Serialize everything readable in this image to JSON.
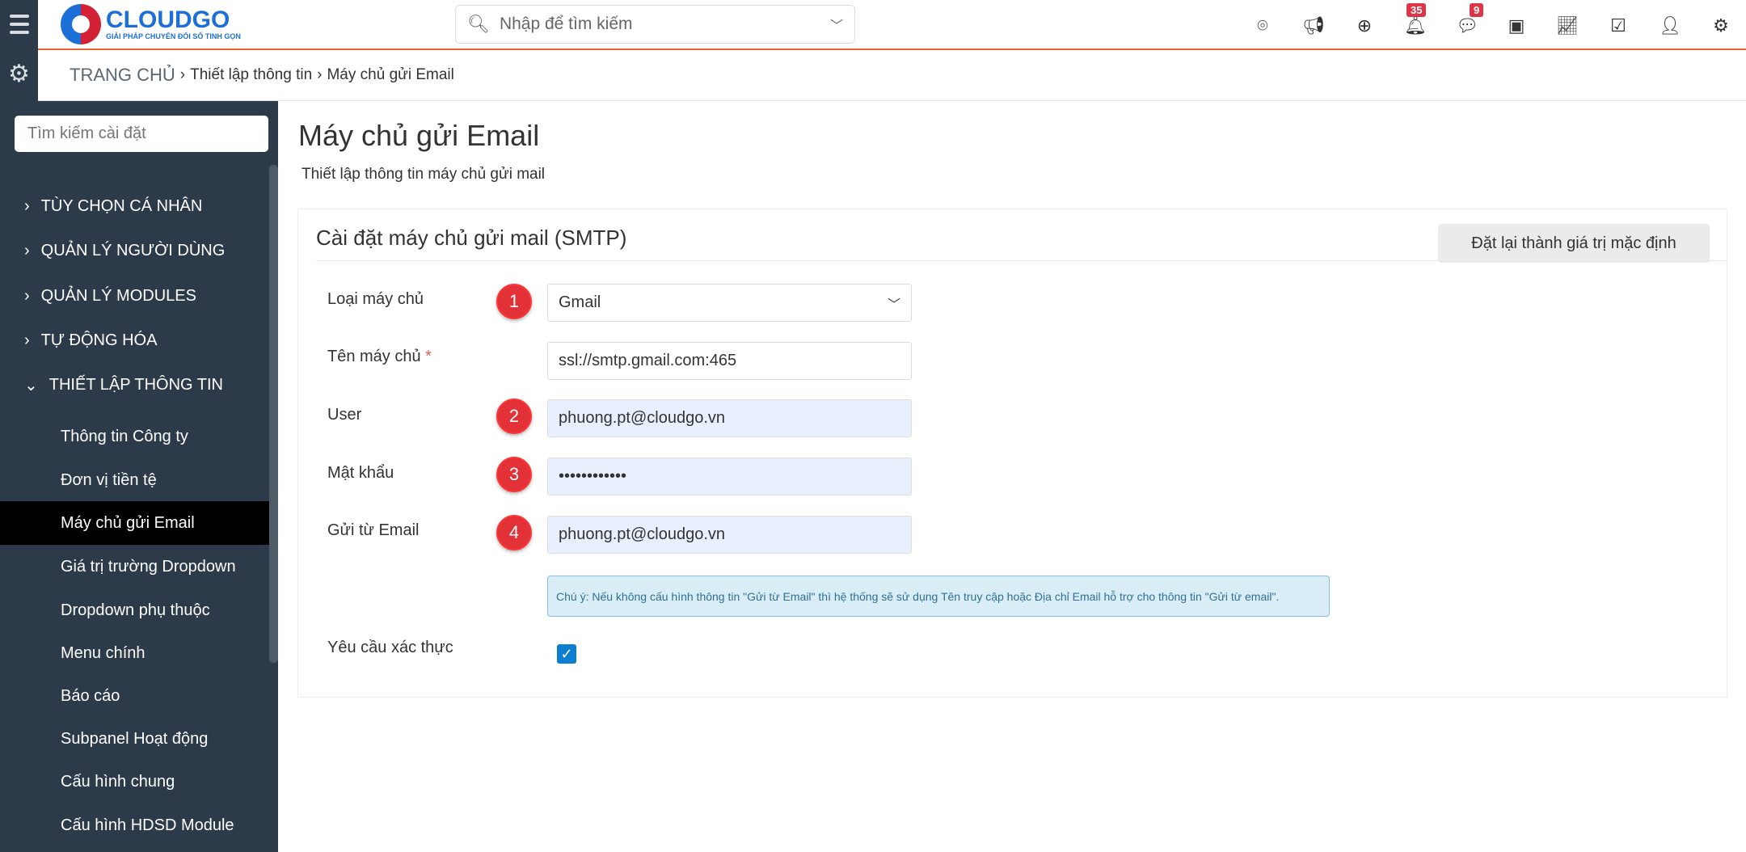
{
  "header": {
    "logo": {
      "name": "CLOUDGO",
      "tagline": "GIẢI PHÁP CHUYỂN ĐỔI SỐ TINH GỌN"
    },
    "search_placeholder": "Nhập để tìm kiếm",
    "notifications_count": "35",
    "messages_count": "9",
    "accent": "#e8622a"
  },
  "breadcrumb": {
    "home": "TRANG CHỦ",
    "items": [
      "Thiết lập thông tin",
      "Máy chủ gửi Email"
    ]
  },
  "sidebar": {
    "search_placeholder": "Tìm kiếm cài đặt",
    "sections": [
      "TÙY CHỌN CÁ NHÂN",
      "QUẢN LÝ NGƯỜI DÙNG",
      "QUẢN LÝ MODULES",
      "TỰ ĐỘNG HÓA",
      "THIẾT LẬP THÔNG TIN"
    ],
    "items": [
      "Thông tin Công ty",
      "Đơn vị tiền tệ",
      "Máy chủ gửi Email",
      "Giá trị trường Dropdown",
      "Dropdown phụ thuộc",
      "Menu chính",
      "Báo cáo",
      "Subpanel Hoạt động",
      "Cấu hình chung",
      "Cấu hình HDSD Module"
    ],
    "active": "Máy chủ gửi Email"
  },
  "page": {
    "title": "Máy chủ gửi Email",
    "subtitle": "Thiết lập thông tin máy chủ gửi mail"
  },
  "card": {
    "title": "Cài đặt máy chủ gửi mail (SMTP)",
    "reset_label": "Đặt lại thành giá trị mặc định",
    "fields": {
      "server_type": {
        "label": "Loại máy chủ",
        "value": "Gmail",
        "marker": "1"
      },
      "server_name": {
        "label": "Tên máy chủ",
        "required": "*",
        "value": "ssl://smtp.gmail.com:465"
      },
      "user": {
        "label": "User",
        "value": "phuong.pt@cloudgo.vn",
        "marker": "2"
      },
      "password": {
        "label": "Mật khẩu",
        "value": "••••••••••••",
        "marker": "3"
      },
      "from_email": {
        "label": "Gửi từ Email",
        "value": "phuong.pt@cloudgo.vn",
        "marker": "4"
      },
      "auth": {
        "label": "Yêu cầu xác thực",
        "checked": true
      }
    },
    "note": "Chú ý: Nếu không cấu hình thông tin \"Gửi từ Email\" thì hệ thống sẽ sử dụng Tên truy cập hoặc Địa chỉ Email hỗ trợ cho thông tin \"Gửi từ email\"."
  }
}
